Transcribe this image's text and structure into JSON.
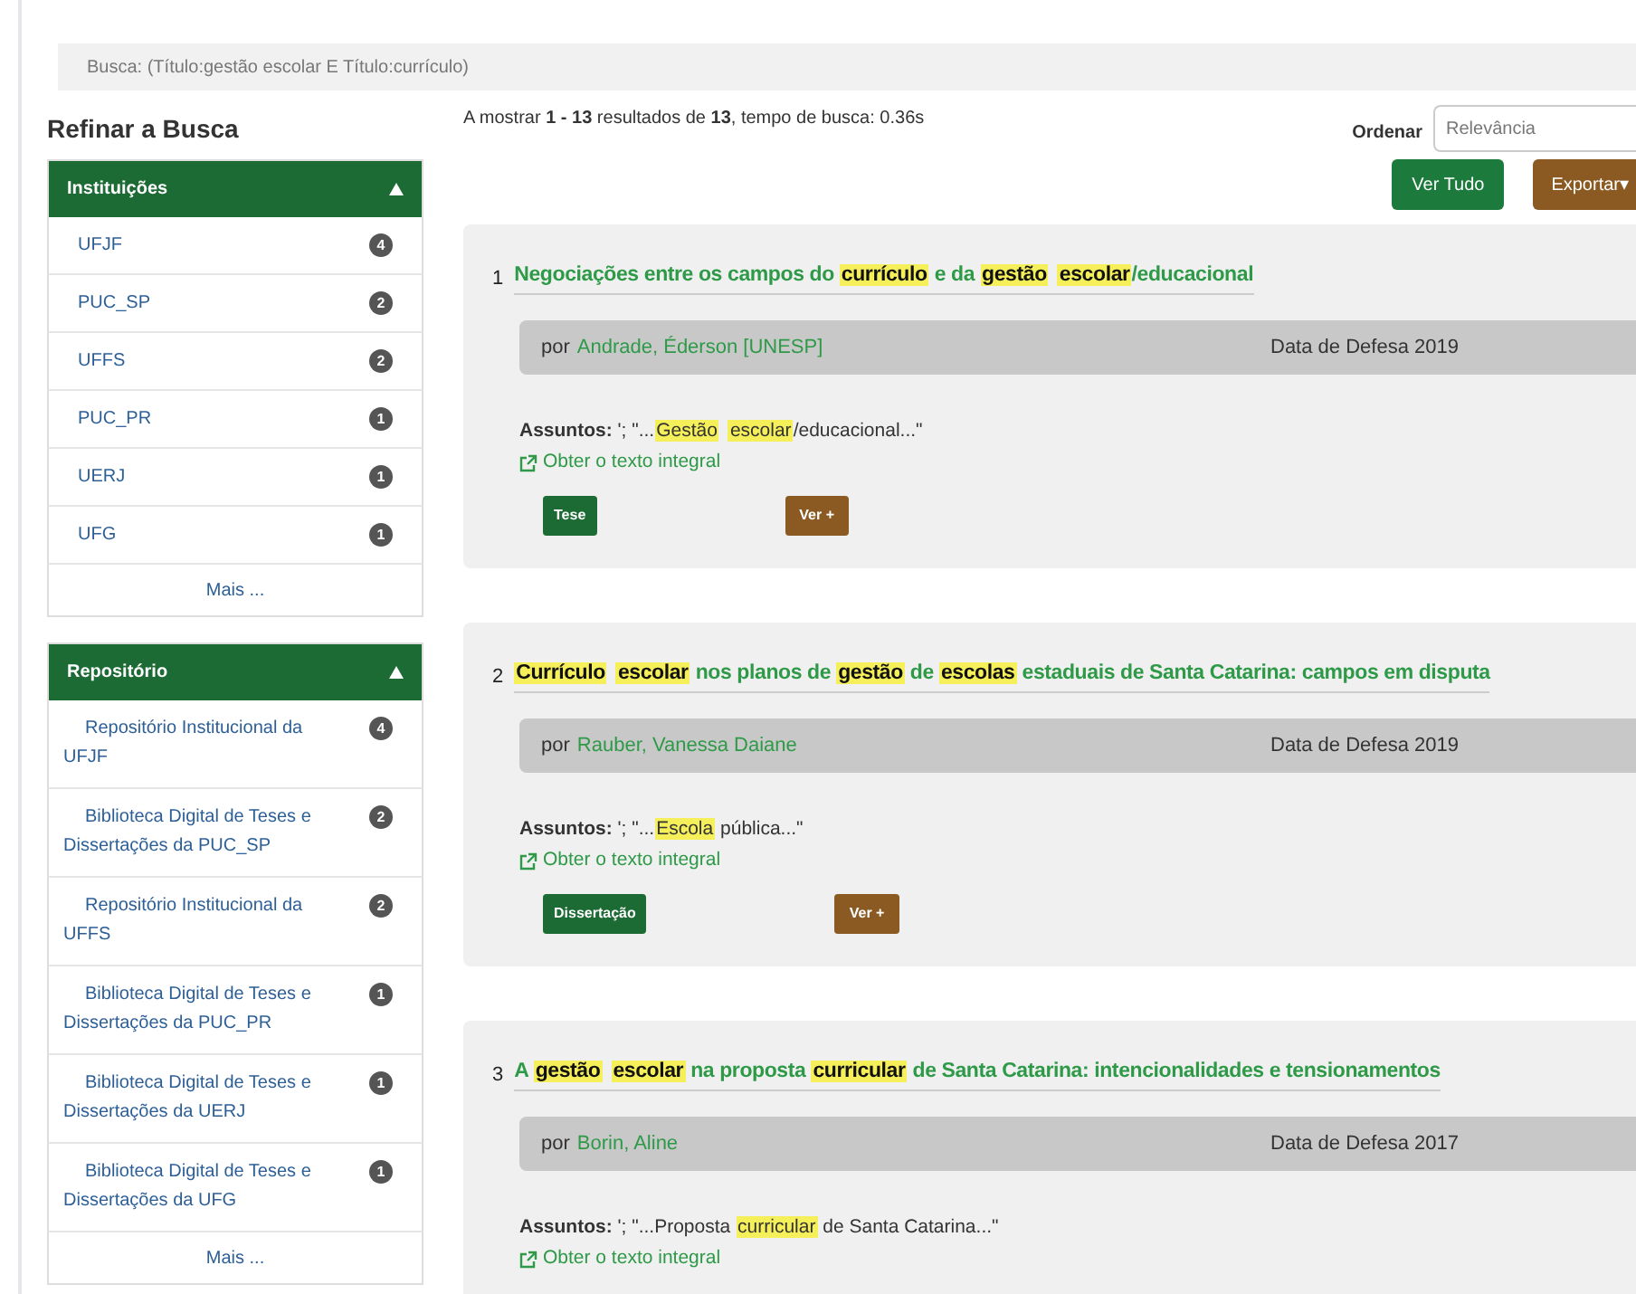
{
  "search_query": "Busca: (Título:gestão escolar E Título:currículo)",
  "refine": {
    "title": "Refinar a Busca",
    "facets": [
      {
        "title": "Instituições",
        "expanded": true,
        "items": [
          {
            "label": "UFJF",
            "count": "4"
          },
          {
            "label": "PUC_SP",
            "count": "2"
          },
          {
            "label": "UFFS",
            "count": "2"
          },
          {
            "label": "PUC_PR",
            "count": "1"
          },
          {
            "label": "UERJ",
            "count": "1"
          },
          {
            "label": "UFG",
            "count": "1"
          }
        ],
        "more": "Mais ..."
      },
      {
        "title": "Repositório",
        "expanded": true,
        "items": [
          {
            "label": "Repositório Institucional da UFJF",
            "count": "4"
          },
          {
            "label": "Biblioteca Digital de Teses e Dissertações da PUC_SP",
            "count": "2"
          },
          {
            "label": "Repositório Institucional da UFFS",
            "count": "2"
          },
          {
            "label": "Biblioteca Digital de Teses e Dissertações da PUC_PR",
            "count": "1"
          },
          {
            "label": "Biblioteca Digital de Teses e Dissertações da UERJ",
            "count": "1"
          },
          {
            "label": "Biblioteca Digital de Teses e Dissertações da UFG",
            "count": "1"
          }
        ],
        "more": "Mais ..."
      }
    ]
  },
  "summary": "A mostrar **1 - 13** resultados de **13**, tempo de busca: 0.36s",
  "sort": {
    "label": "Ordenar",
    "value": "Relevância"
  },
  "buttons": [
    {
      "label": "Ver Tudo",
      "kind": "green"
    },
    {
      "label": "Exportar▾",
      "kind": "brown"
    }
  ],
  "results": [
    {
      "number": "1",
      "title": [
        {
          "text": "Negociações entre os campos do ",
          "highlight": false
        },
        {
          "text": "currículo",
          "highlight": true
        },
        {
          "text": " e da ",
          "highlight": false
        },
        {
          "text": "gestão",
          "highlight": true
        },
        {
          "text": "escolar",
          "highlight": true
        },
        {
          "text": "/educacional",
          "highlight": false
        }
      ],
      "by": "por",
      "author": "Andrade, Éderson [UNESP]",
      "date": "Data de Defesa 2019",
      "subjects_label": "Assuntos:",
      "subjects": [
        {
          "text": " '; \"...",
          "highlight": false
        },
        {
          "text": "Gestão",
          "highlight": true
        },
        {
          "text": "escolar",
          "highlight": true
        },
        {
          "text": "/educacional...\"",
          "highlight": false
        }
      ],
      "fulltext": "Obter o texto integral",
      "type": "Tese",
      "more": "Ver +"
    },
    {
      "number": "2",
      "title": [
        {
          "text": "Currículo",
          "highlight": true
        },
        {
          "text": "escolar",
          "highlight": true
        },
        {
          "text": " nos planos de ",
          "highlight": false
        },
        {
          "text": "gestão",
          "highlight": true
        },
        {
          "text": " de ",
          "highlight": false
        },
        {
          "text": "escolas",
          "highlight": true
        },
        {
          "text": " estaduais de Santa Catarina: campos em disputa",
          "highlight": false
        }
      ],
      "by": "por",
      "author": "Rauber, Vanessa Daiane",
      "date": "Data de Defesa 2019",
      "subjects_label": "Assuntos:",
      "subjects": [
        {
          "text": " '; \"...",
          "highlight": false
        },
        {
          "text": "Escola",
          "highlight": true
        },
        {
          "text": " pública...\"",
          "highlight": false
        }
      ],
      "fulltext": "Obter o texto integral",
      "type": "Dissertação",
      "more": "Ver +"
    },
    {
      "number": "3",
      "title": [
        {
          "text": "A ",
          "highlight": false
        },
        {
          "text": "gestão",
          "highlight": true
        },
        {
          "text": "escolar",
          "highlight": true
        },
        {
          "text": " na proposta ",
          "highlight": false
        },
        {
          "text": "curricular",
          "highlight": true
        },
        {
          "text": " de Santa Catarina: intencionalidades e tensionamentos",
          "highlight": false
        }
      ],
      "by": "por",
      "author": "Borin, Aline",
      "date": "Data de Defesa 2017",
      "subjects_label": "Assuntos:",
      "subjects": [
        {
          "text": " '; \"...Proposta ",
          "highlight": false
        },
        {
          "text": "curricular",
          "highlight": true
        },
        {
          "text": " de Santa Catarina...\"",
          "highlight": false
        }
      ],
      "fulltext": "Obter o texto integral"
    }
  ]
}
